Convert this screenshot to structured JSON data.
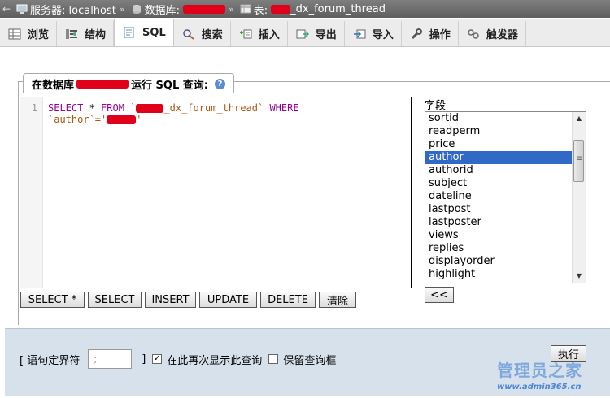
{
  "breadcrumb": {
    "back": "←",
    "server_label": "服务器: localhost",
    "db_label": "数据库:",
    "table_label": "表:",
    "table_suffix": "_dx_forum_thread",
    "separator": "»"
  },
  "tabs": [
    {
      "label": "浏览",
      "icon": "browse-icon"
    },
    {
      "label": "结构",
      "icon": "structure-icon"
    },
    {
      "label": "SQL",
      "icon": "sql-icon",
      "active": true
    },
    {
      "label": "搜索",
      "icon": "search-icon"
    },
    {
      "label": "插入",
      "icon": "insert-icon"
    },
    {
      "label": "导出",
      "icon": "export-icon"
    },
    {
      "label": "导入",
      "icon": "import-icon"
    },
    {
      "label": "操作",
      "icon": "wrench-icon"
    },
    {
      "label": "触发器",
      "icon": "trigger-icon"
    }
  ],
  "query_panel": {
    "legend_prefix": "在数据库",
    "legend_suffix": "运行 SQL 查询:",
    "help": "?"
  },
  "editor": {
    "line_number": "1",
    "kw_select": "SELECT",
    "star": " * ",
    "kw_from": "FROM",
    "table_tick_open": " `",
    "table_suffix": "_dx_forum_thread`",
    "kw_where": " WHERE",
    "col": "`author`='",
    "close_quote": "'"
  },
  "sql_buttons": [
    "SELECT *",
    "SELECT",
    "INSERT",
    "UPDATE",
    "DELETE",
    "清除"
  ],
  "fields_label": "字段",
  "fields": [
    "sortid",
    "readperm",
    "price",
    "author",
    "authorid",
    "subject",
    "dateline",
    "lastpost",
    "lastposter",
    "views",
    "replies",
    "displayorder",
    "highlight"
  ],
  "selected_field": "author",
  "insert_button": "<<",
  "bottom": {
    "delimiter_label": "[ 语句定界符",
    "delimiter_value": ";",
    "delimiter_close": "]",
    "show_again_label": "在此再次显示此查询",
    "show_again_checked": "✓",
    "retain_label": "保留查询框",
    "execute_button": "执行"
  },
  "watermark": {
    "text": "管理员之家",
    "url": "www.admin365.cn"
  },
  "colors": {
    "redaction": "#e0001a",
    "selection": "#3169c6",
    "bottom_bg": "#d7e1ec"
  }
}
